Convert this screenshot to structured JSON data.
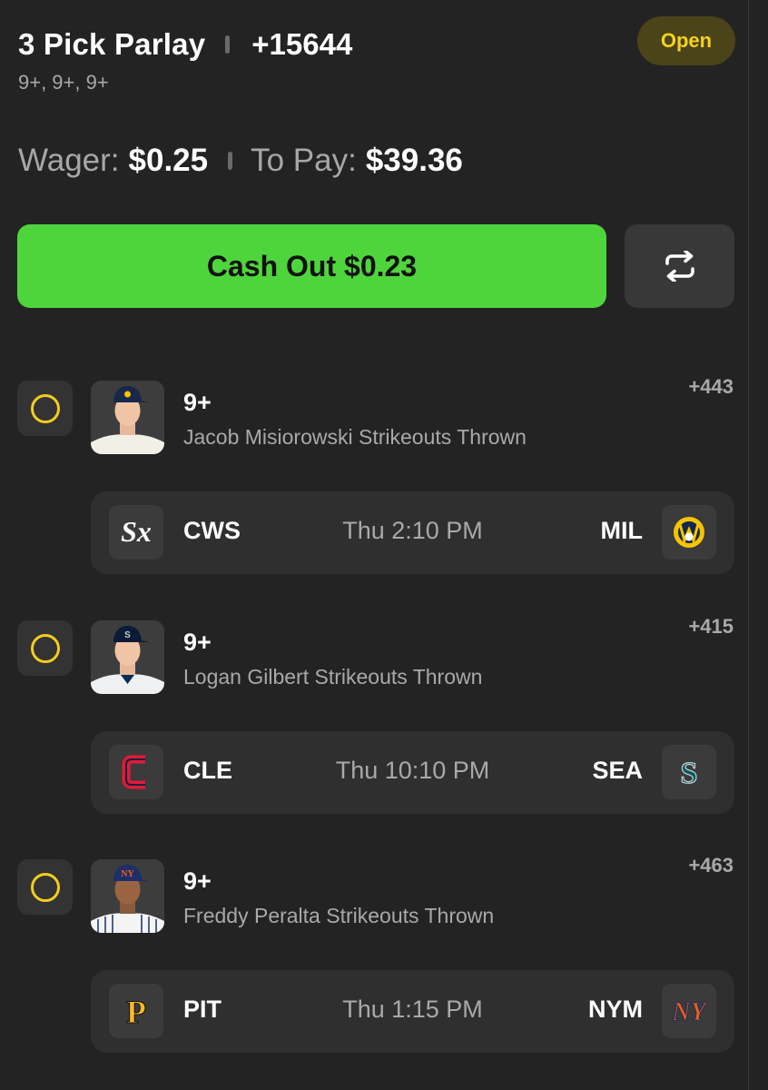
{
  "header": {
    "title": "3 Pick Parlay",
    "odds": "+15644",
    "legs_summary": "9+, 9+, 9+",
    "status": "Open"
  },
  "wager": {
    "wager_label": "Wager:",
    "wager_value": "$0.25",
    "pay_label": "To Pay:",
    "pay_value": "$39.36"
  },
  "actions": {
    "cashout_label": "Cash Out $0.23",
    "refresh_icon": "refresh-icon"
  },
  "legs": [
    {
      "line": "9+",
      "desc": "Jacob Misiorowski Strikeouts Thrown",
      "odds": "+443",
      "away": "CWS",
      "home": "MIL",
      "time": "Thu 2:10 PM"
    },
    {
      "line": "9+",
      "desc": "Logan Gilbert Strikeouts Thrown",
      "odds": "+415",
      "away": "CLE",
      "home": "SEA",
      "time": "Thu 10:10 PM"
    },
    {
      "line": "9+",
      "desc": "Freddy Peralta Strikeouts Thrown",
      "odds": "+463",
      "away": "PIT",
      "home": "NYM",
      "time": "Thu 1:15 PM"
    }
  ],
  "colors": {
    "background": "#232323",
    "cashout_green": "#4fd53c",
    "status_yellow": "#f5d21c",
    "check_yellow": "#f2cd1f"
  }
}
